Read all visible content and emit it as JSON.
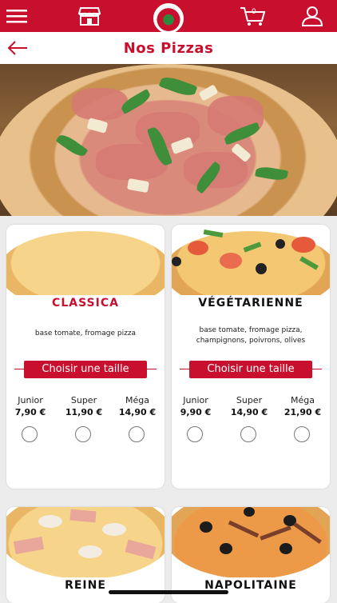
{
  "header": {
    "menu_icon": "hamburger-menu-icon",
    "shop_icon": "storefront-icon",
    "logo_icon": "brand-logo",
    "cart_icon": "cart-icon",
    "cart_count": "0",
    "account_icon": "user-icon",
    "accent_color": "#c8102e"
  },
  "titlebar": {
    "back_icon": "back-arrow-icon",
    "title": "Nos Pizzas"
  },
  "pizzas": [
    {
      "name": "CLASSICA",
      "name_color": "#c8102e",
      "description": "base tomate, fromage pizza",
      "button": "Choisir une taille",
      "sizes": [
        {
          "label": "Junior",
          "price": "7,90 €"
        },
        {
          "label": "Super",
          "price": "11,90 €"
        },
        {
          "label": "Méga",
          "price": "14,90 €"
        }
      ]
    },
    {
      "name": "VÉGÉTARIENNE",
      "name_color": "#111111",
      "description": "base tomate, fromage pizza, champignons, poivrons, olives",
      "button": "Choisir une taille",
      "sizes": [
        {
          "label": "Junior",
          "price": "9,90 €"
        },
        {
          "label": "Super",
          "price": "14,90 €"
        },
        {
          "label": "Méga",
          "price": "21,90 €"
        }
      ]
    },
    {
      "name": "REINE"
    },
    {
      "name": "NAPOLITAINE"
    }
  ]
}
